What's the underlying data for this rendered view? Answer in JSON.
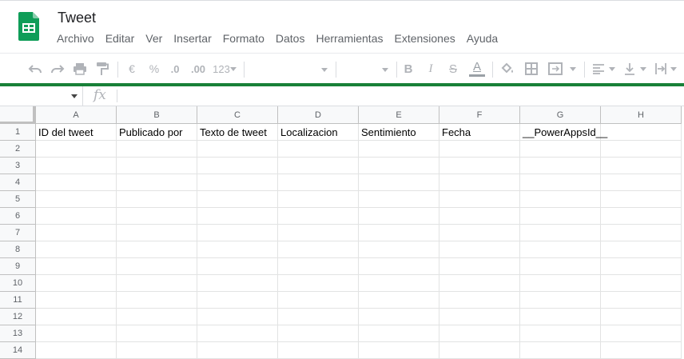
{
  "app": {
    "doc_title": "Tweet",
    "brand_color": "#0f9d58",
    "accent_green": "#188038"
  },
  "menu": [
    "Archivo",
    "Editar",
    "Ver",
    "Insertar",
    "Formato",
    "Datos",
    "Herramientas",
    "Extensiones",
    "Ayuda"
  ],
  "toolbar": {
    "currency_label": "€",
    "percent_label": "%",
    "decrease_decimal_label": ".0",
    "increase_decimal_label": ".00",
    "more_formats_label": "123",
    "bold_label": "B",
    "italic_label": "I",
    "strike_label": "S",
    "text_color_label": "A"
  },
  "formula_bar": {
    "name_box_value": "",
    "fx_label": "fx",
    "formula_value": ""
  },
  "sheet": {
    "columns": [
      "A",
      "B",
      "C",
      "D",
      "E",
      "F",
      "G",
      "H"
    ],
    "rows": [
      "1",
      "2",
      "3",
      "4",
      "5",
      "6",
      "7",
      "8",
      "9",
      "10",
      "11",
      "12",
      "13",
      "14"
    ],
    "row1": [
      "ID del tweet",
      "Publicado por",
      "Texto de tweet",
      "Localizacion",
      "Sentimiento",
      "Fecha",
      "__PowerAppsId__",
      ""
    ]
  }
}
